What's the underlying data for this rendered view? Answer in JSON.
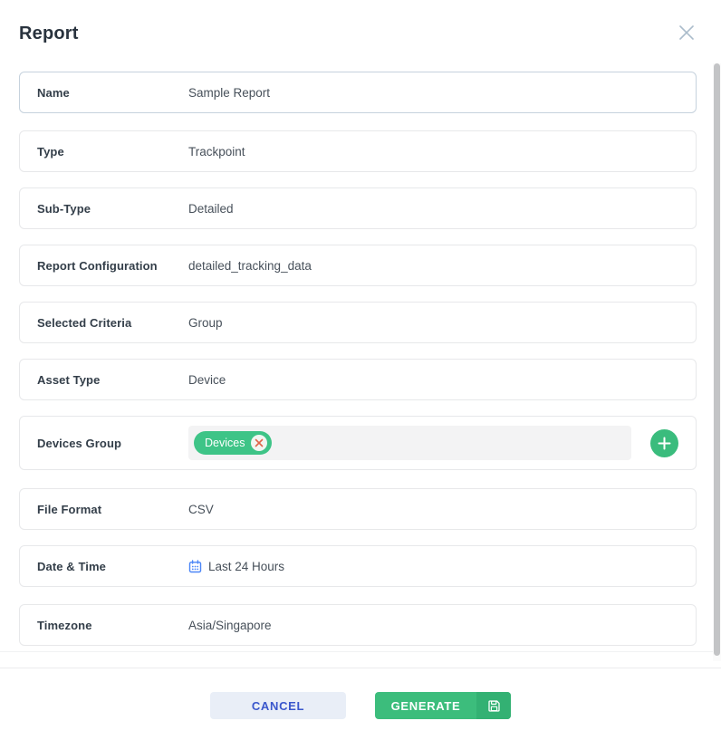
{
  "modal": {
    "title": "Report"
  },
  "rows": [
    {
      "label": "Name",
      "value": "Sample Report"
    },
    {
      "label": "Type",
      "value": "Trackpoint"
    },
    {
      "label": "Sub-Type",
      "value": "Detailed"
    },
    {
      "label": "Report Configuration",
      "value": "detailed_tracking_data"
    },
    {
      "label": "Selected Criteria",
      "value": "Group"
    },
    {
      "label": "Asset Type",
      "value": "Device"
    },
    {
      "label": "Devices Group",
      "chip": "Devices",
      "chip_remove_icon": "x-circle-icon",
      "add_icon": "plus-icon"
    },
    {
      "label": "File Format",
      "value": "CSV"
    },
    {
      "label": "Date & Time",
      "value": "Last 24 Hours",
      "icon": "calendar-icon"
    },
    {
      "label": "Timezone",
      "value": "Asia/Singapore"
    }
  ],
  "footer": {
    "cancel_label": "CANCEL",
    "generate_label": "GENERATE",
    "generate_icon": "save-floppy-icon"
  },
  "icons": {
    "close": "close-x-icon"
  },
  "colors": {
    "chip_green": "#3ec487",
    "add_green": "#3abc7d",
    "generate_green": "#3cbd7c",
    "generate_icon_green": "#33b173",
    "cancel_bg": "#e9eef7",
    "cancel_text": "#3a57cc",
    "calendar_blue": "#4b86f7",
    "chip_x_orange": "#e0654a",
    "close_gray_blue": "#abbccb",
    "title_dark": "#29333e"
  }
}
